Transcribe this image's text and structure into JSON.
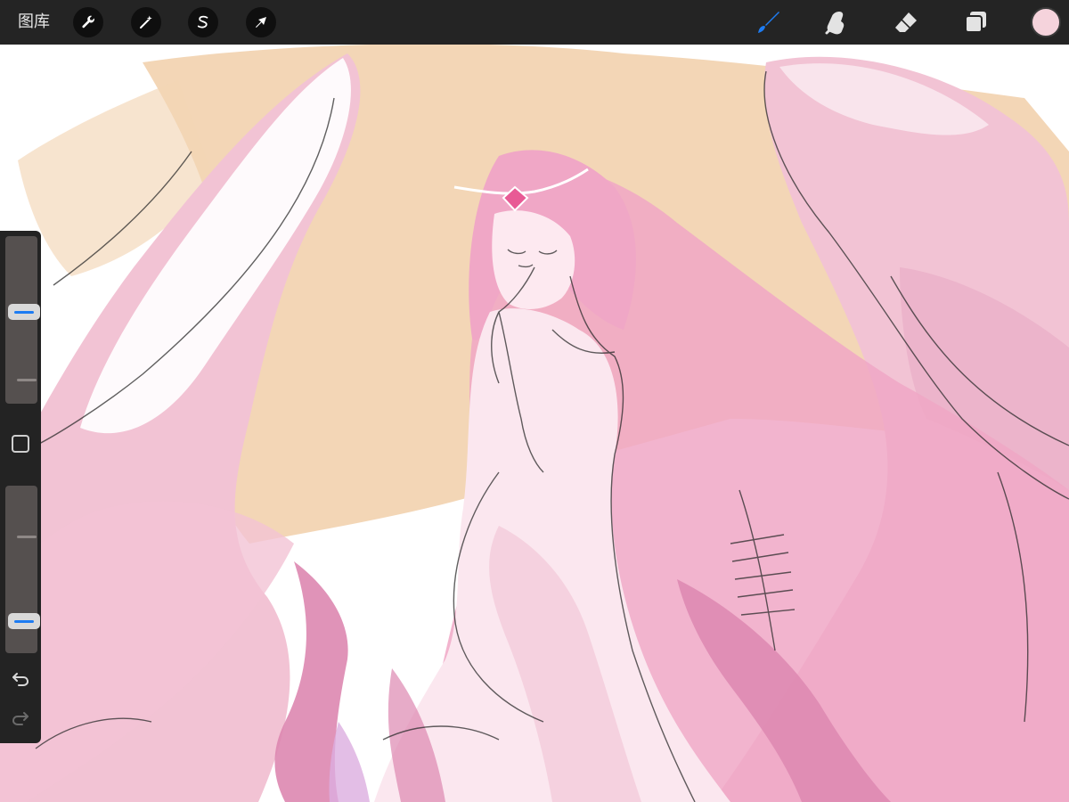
{
  "toolbar": {
    "gallery_label": "图库",
    "actions_icon": "wrench-icon",
    "adjustments_icon": "magic-wand-icon",
    "selection_icon": "selection-s-icon",
    "transform_icon": "arrow-cursor-icon",
    "brush_icon": "brush-icon",
    "smudge_icon": "smudge-finger-icon",
    "eraser_icon": "eraser-icon",
    "layers_icon": "layers-icon",
    "active_color": "#f5d3dc",
    "active_tool_color": "#1e7cf2"
  },
  "sidebar": {
    "brush_size_level": 0.55,
    "opacity_level": 0.16,
    "modify_icon": "square-modify-icon",
    "undo_icon": "undo-arrow-icon",
    "redo_icon": "redo-arrow-icon"
  },
  "canvas": {
    "background": "#ffffff",
    "sky_color": "#f3d6b6",
    "wing_color": "#f2c3d4",
    "hair_color": "#f0a7c6",
    "dress_color": "#fbe7ef",
    "shadow_color": "#dd87b0"
  }
}
